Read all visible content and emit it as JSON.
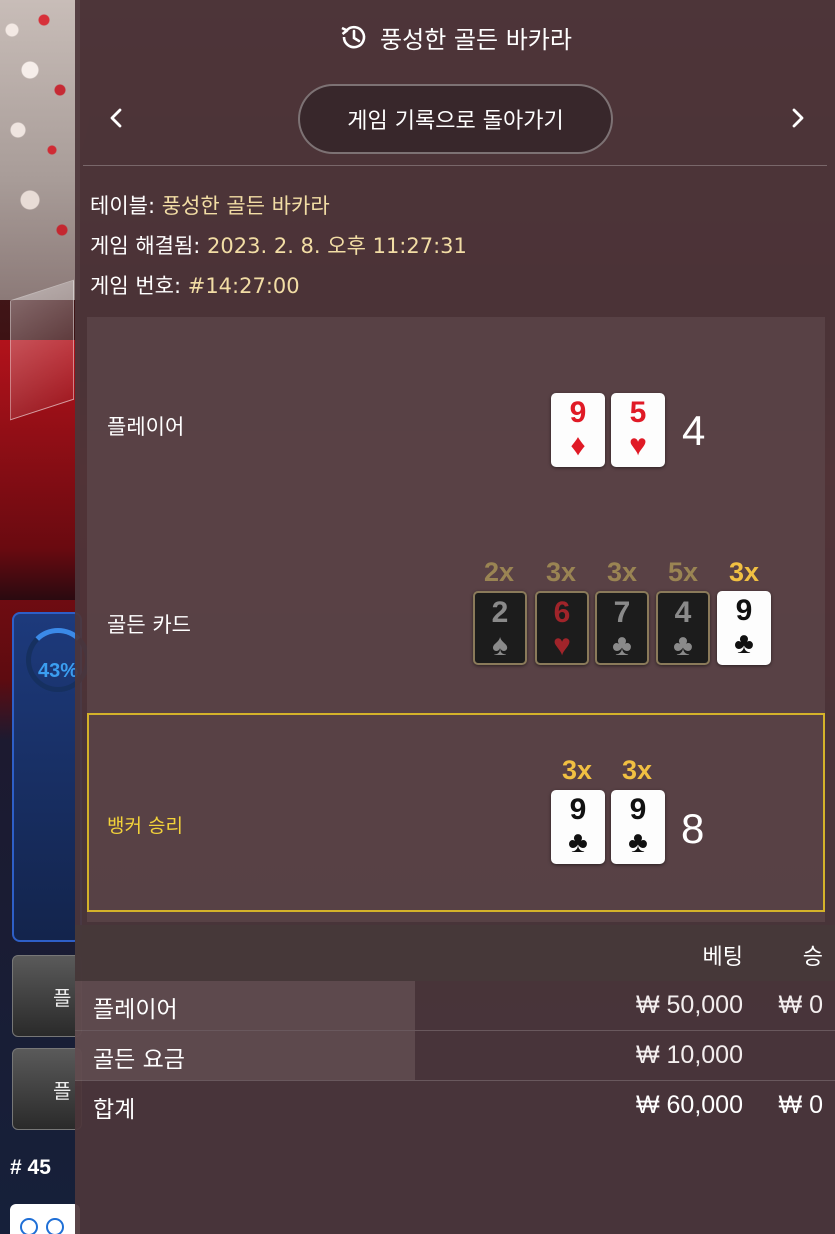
{
  "background": {
    "timer_percent": "43%",
    "round_number": "# 45",
    "side_button_1": "플",
    "side_button_2": "플"
  },
  "header": {
    "title": "풍성한 골든 바카라",
    "icon": "history-icon"
  },
  "nav": {
    "back_label": "게임 기록으로 돌아가기",
    "prev_icon": "chevron-left-icon",
    "next_icon": "chevron-right-icon"
  },
  "info": {
    "table_label": "테이블:",
    "table_value": "풍성한 골든 바카라",
    "resolved_label": "게임 해결됨:",
    "resolved_value": "2023. 2. 8. 오후 11:27:31",
    "game_no_label": "게임 번호:",
    "game_no_value": "#14:27:00"
  },
  "result": {
    "player": {
      "label": "플레이어",
      "score": "4",
      "cards": [
        {
          "rank": "9",
          "suit": "♦",
          "color": "red"
        },
        {
          "rank": "5",
          "suit": "♥",
          "color": "red"
        }
      ]
    },
    "golden": {
      "label": "골든 카드",
      "cards": [
        {
          "rank": "2",
          "suit": "♠",
          "mult": "2x",
          "active": false
        },
        {
          "rank": "6",
          "suit": "♥",
          "mult": "3x",
          "active": false
        },
        {
          "rank": "7",
          "suit": "♣",
          "mult": "3x",
          "active": false
        },
        {
          "rank": "4",
          "suit": "♣",
          "mult": "5x",
          "active": false
        },
        {
          "rank": "9",
          "suit": "♣",
          "mult": "3x",
          "active": true
        }
      ]
    },
    "banker": {
      "label": "뱅커 승리",
      "score": "8",
      "cards": [
        {
          "rank": "9",
          "suit": "♣",
          "mult": "3x"
        },
        {
          "rank": "9",
          "suit": "♣",
          "mult": "3x"
        }
      ]
    }
  },
  "bets": {
    "headers": {
      "bet": "베팅",
      "win": "승"
    },
    "rows": [
      {
        "label": "플레이어",
        "bet": "₩ 50,000",
        "win": "₩ 0"
      },
      {
        "label": "골든 요금",
        "bet": "₩ 10,000",
        "win": ""
      }
    ],
    "total": {
      "label": "합계",
      "bet": "₩ 60,000",
      "win": "₩ 0"
    }
  },
  "colors": {
    "accent_gold": "#f1c042",
    "win_highlight": "#d4b22a",
    "info_value": "#f2dda5"
  }
}
